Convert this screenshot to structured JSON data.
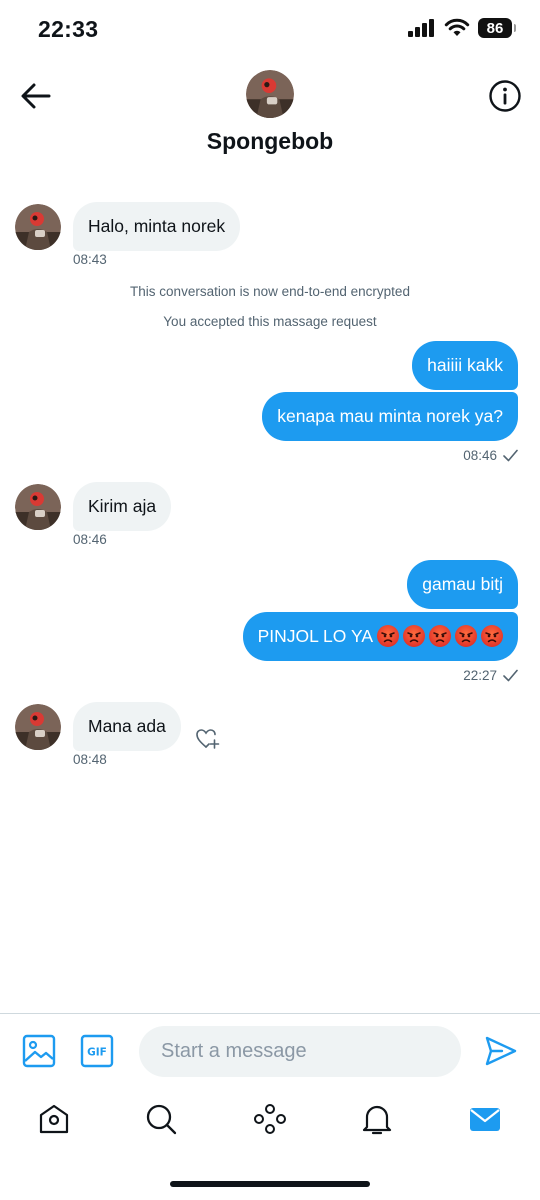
{
  "status_bar": {
    "time": "22:33",
    "battery": "86",
    "icons": [
      "cellular-signal-icon",
      "wifi-icon",
      "battery-icon"
    ]
  },
  "header": {
    "title": "Spongebob",
    "back_icon": "arrow-left-icon",
    "info_icon": "info-icon"
  },
  "messages": [
    {
      "type": "incoming",
      "text": "Halo, minta norek",
      "time": "08:43"
    },
    {
      "type": "system",
      "text": "This conversation is now end-to-end encrypted"
    },
    {
      "type": "system",
      "text": "You accepted this massage request"
    },
    {
      "type": "outgoing",
      "text": "haiiii kakk"
    },
    {
      "type": "outgoing",
      "text": "kenapa mau minta norek ya?",
      "time": "08:46"
    },
    {
      "type": "incoming",
      "text": "Kirim aja",
      "time": "08:46"
    },
    {
      "type": "outgoing",
      "text": "gamau bitj"
    },
    {
      "type": "outgoing",
      "text": "PINJOL LO YA",
      "emoji_count": 5,
      "emoji": "angry-face",
      "time": "22:27"
    },
    {
      "type": "incoming",
      "text": "Mana ada",
      "time": "08:48",
      "reaction_icon": "add-reaction-heart-icon"
    }
  ],
  "composer": {
    "placeholder": "Start a message",
    "icons": [
      "image-icon",
      "gif-icon",
      "send-icon"
    ]
  },
  "bottom_nav": {
    "items": [
      "home-icon",
      "search-icon",
      "communities-icon",
      "notifications-icon",
      "messages-icon"
    ],
    "active": "messages-icon"
  },
  "colors": {
    "accent": "#1d9bf0",
    "incoming_bubble": "#eff3f4",
    "secondary_text": "#536471"
  }
}
